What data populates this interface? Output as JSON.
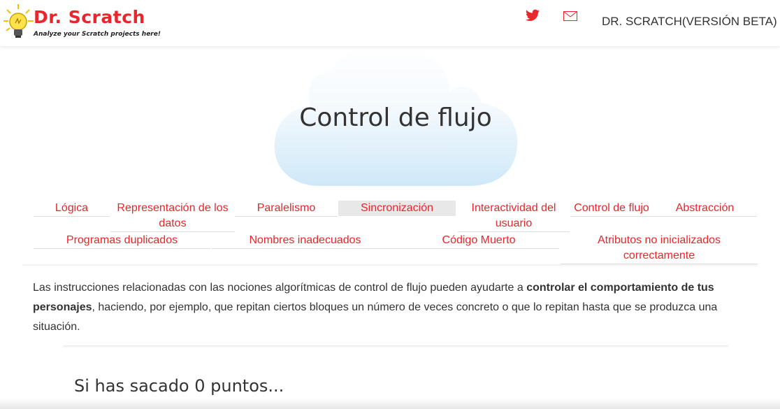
{
  "header": {
    "logo_title": "Dr. Scratch",
    "logo_subtitle": "Analyze your Scratch projects here!",
    "twitter_icon": "twitter-icon",
    "mail_icon": "mail-icon",
    "brand": "DR. SCRATCH(VERSIÓN BETA)"
  },
  "hero": {
    "title": "Control de flujo"
  },
  "tabs": [
    "Lógica",
    "Representación de los datos",
    "Paralelismo",
    "Sincronización",
    "Interactividad del usuario",
    "Control de flujo",
    "Abstracción",
    "Programas duplicados",
    "Nombres inadecuados",
    "Código Muerto",
    "Atributos no inicializados correctamente"
  ],
  "active_tab": "Sincronización",
  "description": {
    "part1": "Las instrucciones relacionadas con las nociones algorítmicas de control de flujo pueden ayudarte a ",
    "bold": "controlar el comportamiento de tus personajes",
    "part2": ", haciendo, por ejemplo, que repitan ciertos bloques un número de veces concreto o que lo repitan hasta que se produzca una situación."
  },
  "score": {
    "heading": "Si has sacado 0 puntos..."
  },
  "colors": {
    "accent": "#e8262b",
    "cloud": "#d6ecfa"
  }
}
